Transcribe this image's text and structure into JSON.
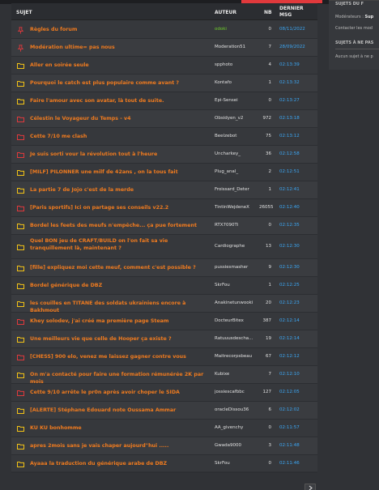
{
  "header": {
    "subject": "SUJET",
    "author": "AUTEUR",
    "nb": "NB",
    "last_line1": "DERNIER",
    "last_line2": "MSG"
  },
  "sidebar": {
    "line1": "SUJETS DU F",
    "moderators_label": "Modérateurs :",
    "moderators_value": "Sup",
    "contact": "Contacter les mod",
    "section": "SUJETS À NE PAS",
    "empty": "Aucun sujet à ne p"
  },
  "topics": [
    {
      "icon": "pin",
      "title": "Règles du forum",
      "author": "odoki",
      "author_green": true,
      "nb": "0",
      "date": "08/11/2022"
    },
    {
      "icon": "pin",
      "title": "Modération ultime= pas nous",
      "author": "Moderation51",
      "nb": "7",
      "date": "28/09/2022"
    },
    {
      "icon": "folder-yellow",
      "title": "Aller en soirée seule",
      "author": "spphoto",
      "nb": "4",
      "date": "02:13:39"
    },
    {
      "icon": "folder-yellow",
      "title": "Pourquoi le catch est plus populaire comme avant ?",
      "author": "Kontafo",
      "nb": "1",
      "date": "02:13:32"
    },
    {
      "icon": "folder-yellow",
      "title": "Faire l'amour avec son avatar, là tout de suite.",
      "author": "Epi-Sensei",
      "nb": "0",
      "date": "02:13:27"
    },
    {
      "icon": "folder-red",
      "title": "Célestin le Voyageur du Temps - v4",
      "author": "Obsidyen_v2",
      "nb": "972",
      "date": "02:13:18"
    },
    {
      "icon": "folder-red",
      "title": "Cette 7/10 me clash",
      "author": "Beelzebot",
      "nb": "75",
      "date": "02:13:12"
    },
    {
      "icon": "folder-red",
      "title": "Je suis sorti vour la révolution tout à l'heure",
      "author": "Uncharkey_",
      "nb": "36",
      "date": "02:12:58"
    },
    {
      "icon": "folder-yellow",
      "title": "[MILF] PILONNER une milf de 42ans , on la tous fait",
      "author": "Plug_anal_",
      "nb": "2",
      "date": "02:12:51"
    },
    {
      "icon": "folder-yellow",
      "title": "La partie 7 de Jojo c'est de la merde",
      "author": "Froissard_Deter",
      "nb": "1",
      "date": "02:12:41"
    },
    {
      "icon": "folder-red",
      "title": "[Paris sportifs] Ici on partage ses conseils v22.2",
      "author": "TintinWejdeneX",
      "nb": "26055",
      "date": "02:12:40"
    },
    {
      "icon": "folder-yellow",
      "title": "Bordel les feets des meufs n'empêche... ça pue fortement",
      "author": "RTX7090Ti",
      "nb": "0",
      "date": "02:12:35"
    },
    {
      "icon": "folder-yellow",
      "title": "Quel BON jeu de CRAFT/BUILD on l'on fait sa vie tranquillement là, maintenant ?",
      "author": "Cardiographe",
      "nb": "13",
      "date": "02:12:30"
    },
    {
      "icon": "folder-yellow",
      "title": "[fille] expliquez moi cette meuf, comment c'est possible ?",
      "author": "pussiesmasher",
      "nb": "9",
      "date": "02:12:30"
    },
    {
      "icon": "folder-yellow",
      "title": "Bordel générique de DBZ",
      "author": "SkrFou",
      "nb": "1",
      "date": "02:12:25"
    },
    {
      "icon": "folder-yellow",
      "title": "les couilles en TITANE des soldats ukrainiens encore à Bakhmout",
      "author": "Anakinetunwooki",
      "nb": "20",
      "date": "02:12:23"
    },
    {
      "icon": "folder-red",
      "title": "Khey solodev, j'ai créé ma première page Steam",
      "author": "DocteurBitex",
      "nb": "387",
      "date": "02:12:14"
    },
    {
      "icon": "folder-yellow",
      "title": "Une meilleurs vie que celle de Hooper ça existe ?",
      "author": "Ratuuusdescha...",
      "nb": "19",
      "date": "02:12:14"
    },
    {
      "icon": "folder-red",
      "title": "[CHESS] 900 elo, venez me laissez gagner contre vous",
      "author": "Maitrecorpsbeau",
      "nb": "67",
      "date": "02:12:12"
    },
    {
      "icon": "folder-yellow",
      "title": "On m'a contacté pour faire une formation rémunérée 2K par mois",
      "author": "Kubixe",
      "nb": "7",
      "date": "02:12:10"
    },
    {
      "icon": "folder-red",
      "title": "Cette 9/10 arrête le pr0n après avoir choper le SIDA",
      "author": "jossiescafbbc",
      "nb": "127",
      "date": "02:12:05"
    },
    {
      "icon": "folder-yellow",
      "title": "[ALERTE] Stéphane Edouard note Oussama Ammar",
      "author": "oracleDissou36",
      "nb": "6",
      "date": "02:12:02"
    },
    {
      "icon": "folder-yellow",
      "title": "KU KU bonhomme",
      "author": "AA_givenchy",
      "nb": "0",
      "date": "02:11:57"
    },
    {
      "icon": "folder-yellow",
      "title": "apres 2mois sans je vais chaper aujourd\"hui .....",
      "author": "Gwada9000",
      "nb": "3",
      "date": "02:11:48"
    },
    {
      "icon": "folder-yellow",
      "title": "Ayaaa la traduction du générique arabe de DBZ",
      "author": "SkrFou",
      "nb": "0",
      "date": "02:11:46"
    }
  ],
  "colors": {
    "title": "#f07b1f",
    "date": "#3ba7f5",
    "folder_yellow": "#f3c316",
    "folder_red": "#e0393c",
    "author_highlight": "#6fcf2a"
  }
}
